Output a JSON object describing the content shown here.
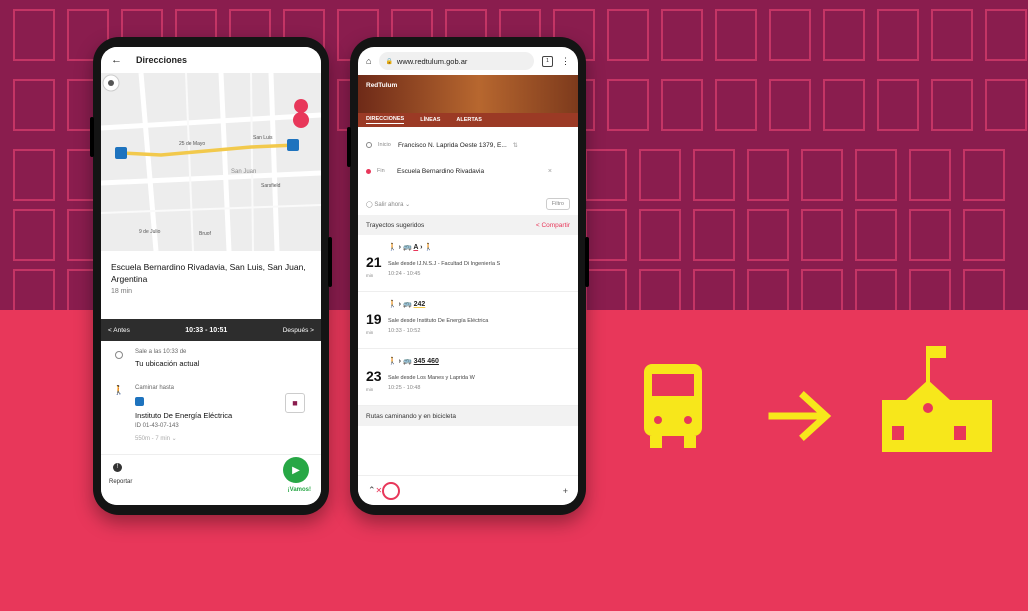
{
  "colors": {
    "banner_top": "#8a1d4e",
    "banner_bottom": "#e8375a",
    "accent_yellow": "#f7e71b",
    "fab_green": "#27a745"
  },
  "phone1": {
    "header_title": "Direcciones",
    "map_labels": [
      "25 de Mayo",
      "San Luis",
      "San Juan",
      "Sarsfield",
      "9 de Julio",
      "Bruof"
    ],
    "destination_name": "Escuela Bernardino Rivadavia, San Luis, San Juan, Argentina",
    "destination_time": "18 min",
    "bar_prev": "< Antes",
    "bar_time": "10:33 - 10:51",
    "bar_next": "Después >",
    "step1_small": "Sale a las 10:33 de",
    "step1_main": "Tu ubicación actual",
    "step2_small": "Caminar hasta",
    "step2_main": "Instituto De Energía Eléctrica",
    "step2_id": "ID 01-43-07-143",
    "step2_meta": "550m - 7 min  ⌄",
    "report_label": "Reportar",
    "go_label": "¡Vamos!"
  },
  "phone2": {
    "url": "www.redtulum.gob.ar",
    "logo": "RedTulum",
    "tabs": [
      "DIRECCIONES",
      "LÍNEAS",
      "ALERTAS"
    ],
    "start_label": "Inicio",
    "start_value": "Francisco N. Laprida Oeste 1379, E...",
    "end_label": "Fin",
    "end_value": "Escuela Bernardino Rivadavia",
    "leave_now": "Salir ahora  ⌄",
    "filter": "Filtro",
    "suggested": "Trayectos sugeridos",
    "share": "< Compartir",
    "trips": [
      {
        "mins": "21",
        "unit": "min",
        "lines": "A",
        "line1": "Sale desde IJ.N.S.J - Facultad Di Ingeniería S",
        "line2": "10:24 - 10:45"
      },
      {
        "mins": "19",
        "unit": "min",
        "lines": "242",
        "line1": "Sale desde Instituto De Energía Eléctrica",
        "line2": "10:33 - 10:52"
      },
      {
        "mins": "23",
        "unit": "min",
        "lines": "345  460",
        "line1": "Sale desde Los Manes y Laprida W",
        "line2": "10:25 - 10:48"
      }
    ],
    "bike_section": "Rutas caminando y en bicicleta"
  }
}
